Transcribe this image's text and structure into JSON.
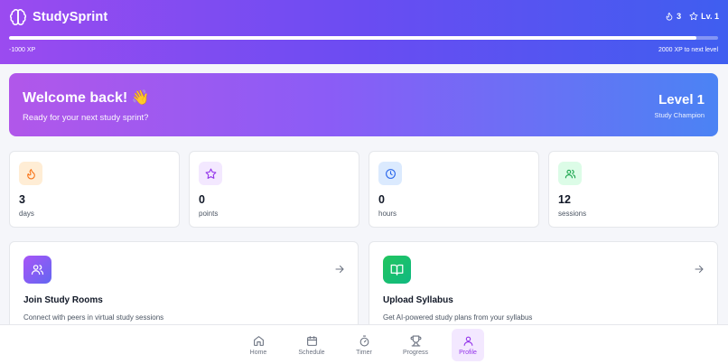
{
  "header": {
    "brand": "StudySprint",
    "streak_count": "3",
    "level_badge": "Lv. 1",
    "xp_left": "-1000 XP",
    "xp_right": "2000 XP to next level",
    "xp_progress_fraction": 0.97,
    "icons": {
      "brand": "brain-icon",
      "streak": "flame-icon",
      "level": "star-icon"
    }
  },
  "welcome": {
    "title": "Welcome back! 👋",
    "subtitle": "Ready for your next study sprint?",
    "level": "Level 1",
    "level_title": "Study Champion"
  },
  "stats": [
    {
      "value": "3",
      "label": "days",
      "icon": "flame-icon",
      "icon_color": "#f97316",
      "icon_bg": "#ffedd5"
    },
    {
      "value": "0",
      "label": "points",
      "icon": "star-icon",
      "icon_color": "#9333ea",
      "icon_bg": "#f3e8ff"
    },
    {
      "value": "0",
      "label": "hours",
      "icon": "clock-icon",
      "icon_color": "#2563eb",
      "icon_bg": "#dbeafe"
    },
    {
      "value": "12",
      "label": "sessions",
      "icon": "users-icon",
      "icon_color": "#16a34a",
      "icon_bg": "#dcfce7"
    }
  ],
  "features": [
    {
      "title": "Join Study Rooms",
      "description": "Connect with peers in virtual study sessions",
      "icon": "users-icon"
    },
    {
      "title": "Upload Syllabus",
      "description": "Get AI-powered study plans from your syllabus",
      "icon": "book-open-icon"
    }
  ],
  "nav": {
    "items": [
      {
        "label": "Home",
        "icon": "home-icon"
      },
      {
        "label": "Schedule",
        "icon": "calendar-icon"
      },
      {
        "label": "Timer",
        "icon": "timer-icon"
      },
      {
        "label": "Progress",
        "icon": "trophy-icon"
      },
      {
        "label": "Profile",
        "icon": "user-icon"
      }
    ],
    "active": "Profile"
  },
  "colors": {
    "header_gradient": [
      "#9b4bf0",
      "#3f5ef0"
    ],
    "welcome_gradient": [
      "#b157ea",
      "#4b83f4"
    ],
    "accent": "#9333ea"
  }
}
